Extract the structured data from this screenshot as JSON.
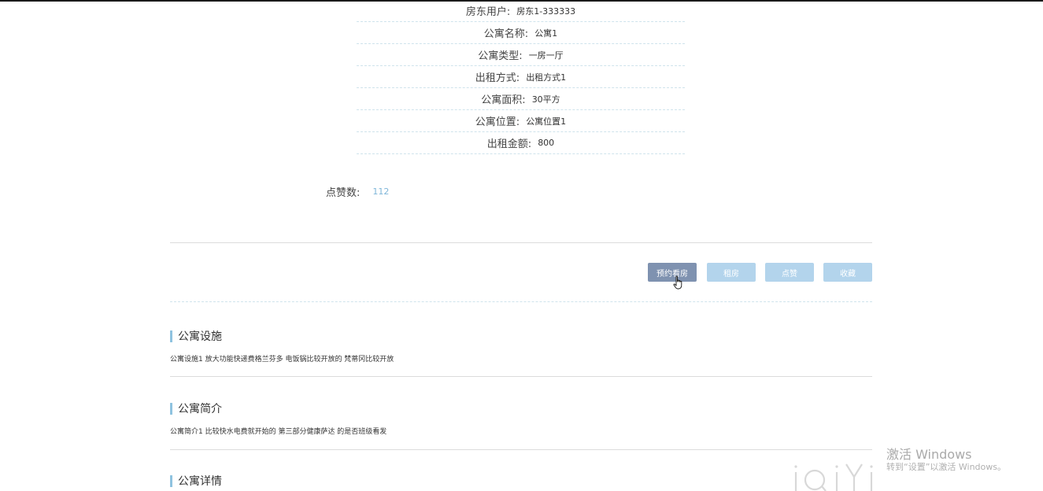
{
  "info": [
    {
      "label": "房东用户:",
      "value": "房东1-333333"
    },
    {
      "label": "公寓名称:",
      "value": "公寓1"
    },
    {
      "label": "公寓类型:",
      "value": "一房一厅"
    },
    {
      "label": "出租方式:",
      "value": "出租方式1"
    },
    {
      "label": "公寓面积:",
      "value": "30平方"
    },
    {
      "label": "公寓位置:",
      "value": "公寓位置1"
    },
    {
      "label": "出租金额:",
      "value": "800"
    }
  ],
  "likes": {
    "label": "点赞数:",
    "value": "112"
  },
  "actions": {
    "book_viewing": "预约看房",
    "rent": "租房",
    "like": "点赞",
    "favorite": "收藏"
  },
  "sections": [
    {
      "title": "公寓设施",
      "body": "公寓设施1 放大功能快递费格兰芬多 电饭锅比较开放的 梵蒂冈比较开放"
    },
    {
      "title": "公寓简介",
      "body": "公寓简介1 比较快水电费就开始的 第三部分健康萨达 的是否班级看发"
    },
    {
      "title": "公寓详情",
      "body": ""
    }
  ],
  "watermark": {
    "title": "激活 Windows",
    "subtitle": "转到“设置”以激活 Windows。",
    "logo": "iQIYI"
  },
  "colors": {
    "primary_button": "#7f92b0",
    "light_button": "#b3d4ec",
    "accent_bar": "#8fc3e0",
    "likes_value": "#7fb6d9"
  }
}
